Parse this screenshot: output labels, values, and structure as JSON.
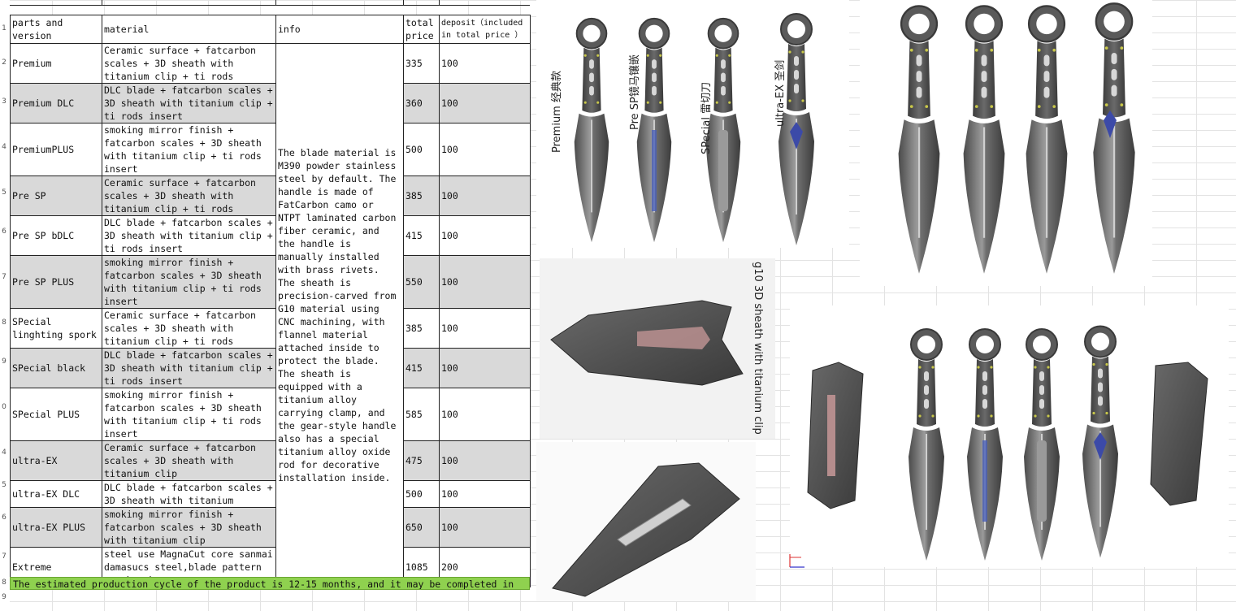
{
  "row_numbers": [
    "1",
    "2",
    "3",
    "4",
    "5",
    "6",
    "7",
    "8",
    "9",
    "0",
    "4",
    "5",
    "6",
    "7",
    "8",
    "9"
  ],
  "table": {
    "headers": {
      "version": "parts and version",
      "material": "material",
      "info": "info",
      "price": "total price",
      "deposit": "deposit（included in total price ）"
    },
    "info_text": "The blade material is M390 powder stainless steel by default. The handle is made of FatCarbon camo or NTPT laminated carbon fiber ceramic, and the handle is manually installed with brass rivets. The sheath is precision-carved from G10 material using CNC machining, with flannel material attached inside to protect the blade. The sheath is equipped with a titanium alloy carrying clamp, and the gear-style handle also has a special titanium alloy oxide rod for decorative installation inside.",
    "rows": [
      {
        "version": "Premium",
        "material": "Ceramic surface + fatcarbon scales + 3D sheath with titanium clip + ti rods",
        "price": "335",
        "deposit": "100"
      },
      {
        "version": "Premium DLC",
        "material": "DLC blade + fatcarbon scales + 3D sheath with titanium clip + ti rods insert",
        "price": "360",
        "deposit": "100"
      },
      {
        "version": "PremiumPLUS",
        "material": "smoking mirror finish + fatcarbon scales + 3D sheath with titanium clip + ti rods insert",
        "price": "500",
        "deposit": "100"
      },
      {
        "version": "Pre SP",
        "material": "Ceramic surface + fatcarbon scales + 3D sheath with titanium clip + ti rods",
        "price": "385",
        "deposit": "100"
      },
      {
        "version": "Pre SP bDLC",
        "material": "DLC blade + fatcarbon scales + 3D sheath with titanium clip + ti rods insert",
        "price": "415",
        "deposit": "100"
      },
      {
        "version": "Pre SP PLUS",
        "material": "smoking mirror finish + fatcarbon scales + 3D sheath with titanium clip + ti rods insert",
        "price": "550",
        "deposit": "100"
      },
      {
        "version": "SPecial linghting spork",
        "material": "Ceramic surface + fatcarbon scales + 3D sheath with titanium clip + ti rods",
        "price": "385",
        "deposit": "100"
      },
      {
        "version": "SPecial black",
        "material": "DLC blade + fatcarbon scales + 3D sheath with titanium clip + ti rods insert",
        "price": "415",
        "deposit": "100"
      },
      {
        "version": "SPecial PLUS",
        "material": "smoking mirror finish + fatcarbon scales + 3D sheath with titanium clip + ti rods insert",
        "price": "585",
        "deposit": "100"
      },
      {
        "version": "ultra-EX",
        "material": "Ceramic surface + fatcarbon scales + 3D sheath with titanium clip",
        "price": "475",
        "deposit": "100"
      },
      {
        "version": "ultra-EX DLC",
        "material": "DLC blade + fatcarbon scales + 3D sheath with titanium",
        "price": "500",
        "deposit": "100"
      },
      {
        "version": "ultra-EX PLUS",
        "material": "smoking mirror finish + fatcarbon scales + 3D sheath with titanium clip",
        "price": "650",
        "deposit": "100"
      },
      {
        "version": "Extreme",
        "material": "steel use MagnaCut core sanmai damasucs steel,blade pattern can be choose",
        "price": "1085",
        "deposit": "200"
      }
    ],
    "footer_note": "The estimated production cycle of the product is 12-15 months, and it may be completed in"
  },
  "image_labels": {
    "premium": "Premium 经典款",
    "pre_sp": "Pre SP镜马镶嵌",
    "special": "SPecial 雷切刀",
    "ultra_ex": "ultra-EX 圣剑",
    "sheath": "g10 3D sheath with titanium clip"
  },
  "colors": {
    "footer_bg": "#8fd14f",
    "alt_row": "#d9d9d9",
    "blade_steel": "#8a8a8a",
    "handle_carbon": "#5a5a5a",
    "inlay_blue": "#4a5fb8"
  }
}
